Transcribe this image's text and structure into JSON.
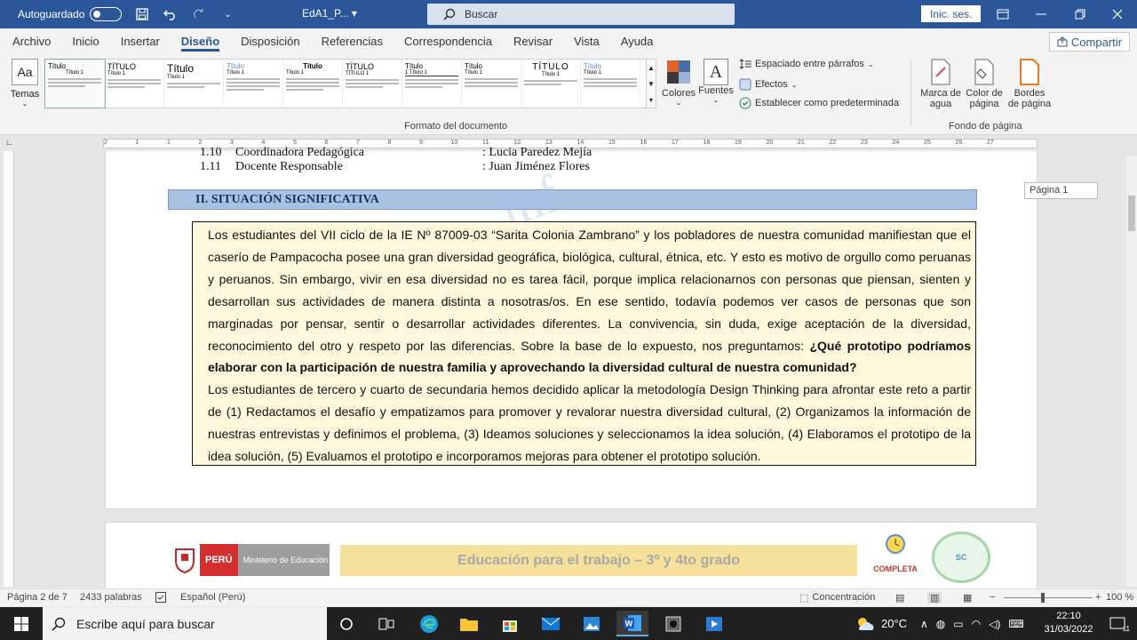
{
  "titlebar": {
    "autosave_label": "Autoguardado",
    "doc_name": "EdA1_P...",
    "search_placeholder": "Buscar",
    "signin_label": "Inic. ses."
  },
  "menu": {
    "tabs": [
      "Archivo",
      "Inicio",
      "Insertar",
      "Diseño",
      "Disposición",
      "Referencias",
      "Correspondencia",
      "Revisar",
      "Vista",
      "Ayuda"
    ],
    "active_tab": "Diseño",
    "share_label": "Compartir"
  },
  "ribbon": {
    "temas_label": "Temas",
    "temas_icon_text": "Aa",
    "gallery": [
      {
        "title": "Título",
        "heading": "Título 1"
      },
      {
        "title": "TÍTULO",
        "heading": "Título 1"
      },
      {
        "title": "Título",
        "heading": "Título 1"
      },
      {
        "title": "Título",
        "heading": "Título 1"
      },
      {
        "title": "Título",
        "heading": "Título 1"
      },
      {
        "title": "TÍTULO",
        "heading": "TÍTULO 1"
      },
      {
        "title": "Título",
        "heading": "1 Título 1"
      },
      {
        "title": "Título",
        "heading": "Título 1"
      },
      {
        "title": "TÍTULO",
        "heading": "Título 1"
      },
      {
        "title": "Título",
        "heading": "Título 1"
      }
    ],
    "colores_label": "Colores",
    "fuentes_label": "Fuentes",
    "fuentes_icon_text": "A",
    "espaciado_label": "Espaciado entre párrafos",
    "efectos_label": "Efectos",
    "establecer_label": "Establecer como predeterminada",
    "formato_group": "Formato del documento",
    "marca_label_1": "Marca de",
    "marca_label_2": "agua",
    "color_label_1": "Color de",
    "color_label_2": "página",
    "bordes_label_1": "Bordes",
    "bordes_label_2": "de página",
    "fondo_group": "Fondo de página"
  },
  "ruler": {
    "numbers": [
      "2",
      "1",
      "1",
      "2",
      "3",
      "4",
      "5",
      "6",
      "7",
      "8",
      "9",
      "10",
      "11",
      "12",
      "13",
      "14",
      "15",
      "16",
      "17",
      "18",
      "19",
      "20",
      "21",
      "22",
      "23",
      "24",
      "25",
      "26",
      "27"
    ]
  },
  "document": {
    "row_110_num": "1.10",
    "row_110_label": "Coordinadora Pedagógica",
    "row_110_value": ": Lucia Paredez Mejía",
    "row_111_num": "1.11",
    "row_111_label": "Docente Responsable",
    "row_111_value": ": Juan Jiménez Flores",
    "section_heading": "II.  SITUACIÓN SIGNIFICATIVA",
    "para1_a": "Los estudiantes del VII ciclo de la IE Nº 87009-03 “Sarita Colonia Zambrano” y los pobladores de nuestra comunidad manifiestan que el caserío de Pampacocha posee una gran diversidad geográfica, biológica, cultural, étnica, etc. Y esto es motivo de orgullo como peruanas y peruanos. Sin embargo, vivir en esa diversidad no es tarea fácil, porque implica relacionarnos con personas que piensan, sienten y desarrollan sus actividades de manera distinta a nosotras/os. En ese sentido, todavía podemos ver casos de personas que son marginadas por pensar, sentir o desarrollar actividades diferentes. La convivencia, sin duda, exige aceptación de la diversidad, reconocimiento del otro y respeto por las diferencias. Sobre la base de lo expuesto, nos preguntamos: ",
    "para1_bold": "¿Qué prototipo podríamos elaborar con la participación de nuestra familia y aprovechando la diversidad cultural de nuestra comunidad?",
    "para2": "Los estudiantes de tercero y cuarto de secundaria hemos decidido aplicar la metodología Design Thinking para afrontar este reto a partir de (1) Redactamos el desafío y empatizamos para promover y revalorar nuestra diversidad cultural, (2) Organizamos la información de nuestras entrevistas y definimos el problema, (3) Ideamos soluciones y seleccionamos la idea solución, (4) Elaboramos el prototipo de la idea solución, (5) Evaluamos el prototipo e incorporamos mejoras para obtener el prototipo solución.",
    "page_tag": "Página 1",
    "banner_peru": "PERÚ",
    "banner_ministerio": "Ministerio de Educación",
    "banner_text": "Educación para el trabajo – 3º y 4to grado",
    "badge_completa": "COMPLETA",
    "badge_sc": "SC"
  },
  "statusbar": {
    "page": "Página 2 de 7",
    "words": "2433 palabras",
    "language": "Español (Perú)",
    "focus": "Concentración",
    "zoom": "100 %"
  },
  "taskbar": {
    "search_placeholder": "Escribe aquí para buscar",
    "temperature": "20°C",
    "time": "22:10",
    "date": "31/03/2022",
    "notif_count": "11"
  }
}
